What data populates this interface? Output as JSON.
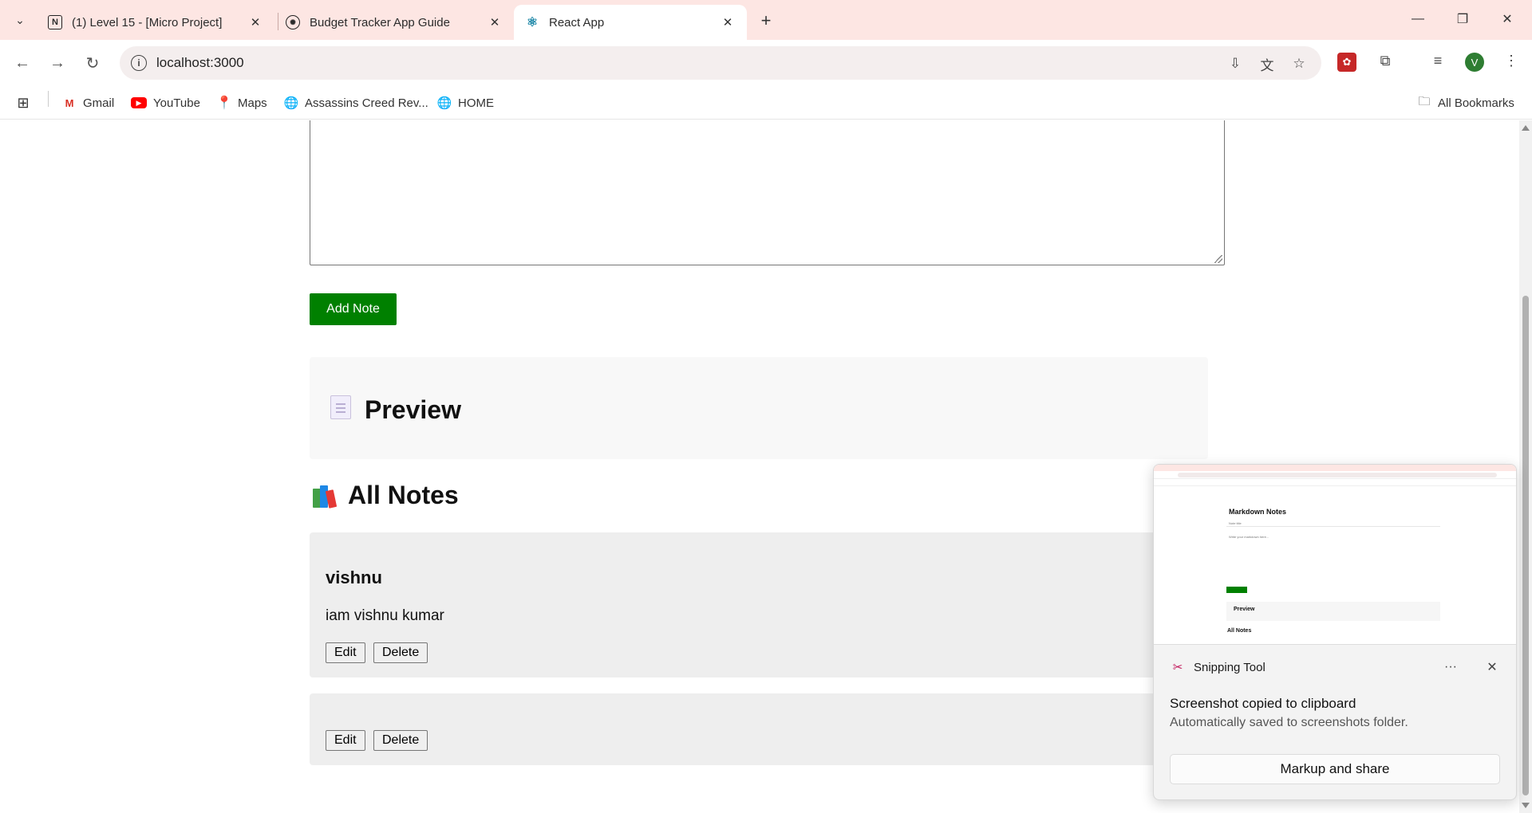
{
  "browser": {
    "tabs": [
      {
        "title": "(1) Level 15 - [Micro Project]",
        "icon": "notion-icon"
      },
      {
        "title": "Budget Tracker App Guide",
        "icon": "openai-icon"
      },
      {
        "title": "React App",
        "icon": "react-icon"
      }
    ],
    "url": "localhost:3000",
    "profile_initial": "V",
    "bookmarks": [
      {
        "label": "Gmail"
      },
      {
        "label": "YouTube"
      },
      {
        "label": "Maps"
      },
      {
        "label": "Assassins Creed Rev..."
      },
      {
        "label": "HOME"
      }
    ],
    "all_bookmarks": "All Bookmarks"
  },
  "page": {
    "add_note_label": "Add Note",
    "preview_title": "Preview",
    "all_notes_title": "All Notes",
    "notes": [
      {
        "title": "vishnu",
        "body": "iam vishnu kumar",
        "edit": "Edit",
        "delete": "Delete"
      },
      {
        "title": "",
        "body": "",
        "edit": "Edit",
        "delete": "Delete"
      }
    ]
  },
  "toast": {
    "app_name": "Snipping Tool",
    "more": "···",
    "message": "Screenshot copied to clipboard",
    "submessage": "Automatically saved to screenshots folder.",
    "action": "Markup and share",
    "thumbnail": {
      "title": "Markdown Notes",
      "input_placeholder": "Note title",
      "textarea_placeholder": "Write your markdown here...",
      "preview": "Preview",
      "all_notes": "All Notes"
    }
  },
  "colors": {
    "add_button": "#008000",
    "tabstrip": "#fde6e3"
  }
}
